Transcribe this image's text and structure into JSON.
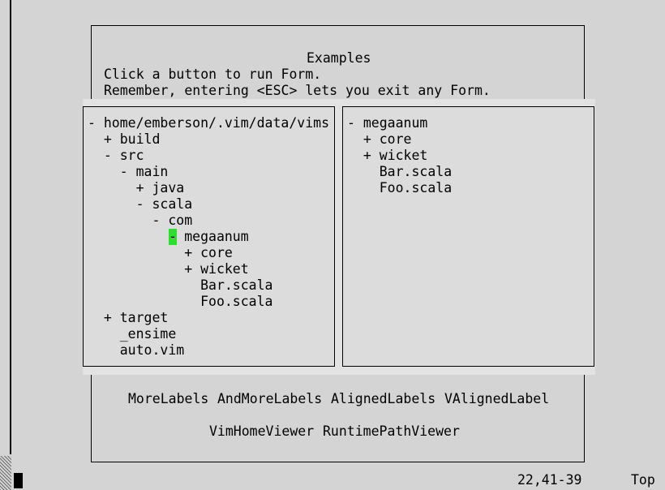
{
  "form": {
    "title": "Examples",
    "line1": "Click a button to run Form.",
    "line2": "Remember, entering <ESC> lets you exit any Form."
  },
  "left_tree": [
    "- home/emberson/.vim/data/vims",
    "  + build",
    "  - src",
    "    - main",
    "      + java",
    "      - scala",
    "        - com",
    "            megaanum",
    "            + core",
    "            + wicket",
    "              Bar.scala",
    "              Foo.scala",
    "  + target",
    "    _ensime",
    "    auto.vim"
  ],
  "cursor_char": "-",
  "right_tree": [
    "- megaanum",
    "  + core",
    "  + wicket",
    "    Bar.scala",
    "    Foo.scala"
  ],
  "buttons_row1": {
    "more_labels": "MoreLabels",
    "and_more_labels": "AndMoreLabels",
    "aligned_labels": "AlignedLabels",
    "valigned_label": "VAlignedLabel"
  },
  "buttons_row2": {
    "vim_home_viewer": "VimHomeViewer",
    "runtime_path_viewer": "RuntimePathViewer"
  },
  "status": {
    "position": "22,41-39",
    "scroll": "Top"
  }
}
